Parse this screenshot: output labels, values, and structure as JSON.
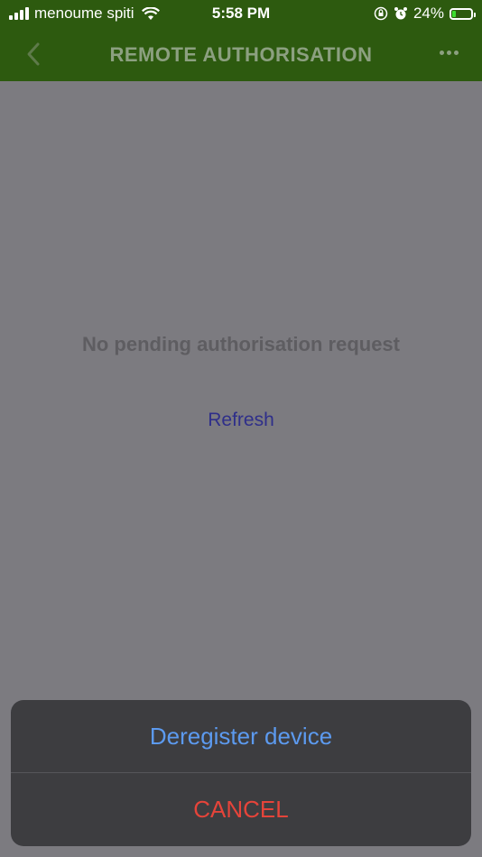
{
  "status_bar": {
    "carrier": "menoume spiti",
    "time": "5:58 PM",
    "battery_percent": "24%",
    "battery_level": 0.24,
    "icons": [
      "signal-icon",
      "wifi-icon",
      "orientation-lock-icon",
      "alarm-icon",
      "battery-charging-icon"
    ]
  },
  "navbar": {
    "title": "REMOTE AUTHORISATION",
    "back_icon": "chevron-left-icon",
    "more_icon": "more-horizontal-icon",
    "bar_color": "#2d5a0f"
  },
  "main": {
    "empty_message": "No pending authorisation request",
    "refresh_label": "Refresh"
  },
  "action_sheet": {
    "deregister_label": "Deregister device",
    "cancel_label": "CANCEL",
    "deregister_color": "#5c9aef",
    "cancel_color": "#e5443a"
  }
}
